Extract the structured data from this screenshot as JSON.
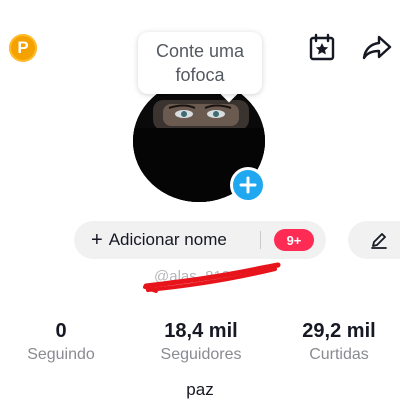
{
  "header": {
    "coin_badge_letter": "P",
    "calendar_icon": "calendar-star-icon",
    "share_icon": "share-arrow-icon"
  },
  "bubble": {
    "text": "Conte uma fofoca"
  },
  "profile": {
    "add_name_label": "Adicionar nome",
    "notification_count": "9+",
    "edit_icon": "pencil-icon",
    "handle_redacted": "@alas_818"
  },
  "stats": [
    {
      "value": "0",
      "label": "Seguindo"
    },
    {
      "value": "18,4 mil",
      "label": "Seguidores"
    },
    {
      "value": "29,2 mil",
      "label": "Curtidas"
    }
  ],
  "bio": "paz",
  "colors": {
    "accent_red": "#fe2c55",
    "accent_blue": "#1fa8f0",
    "coin_orange": "#f5a200",
    "scribble_red": "#e8141c"
  }
}
